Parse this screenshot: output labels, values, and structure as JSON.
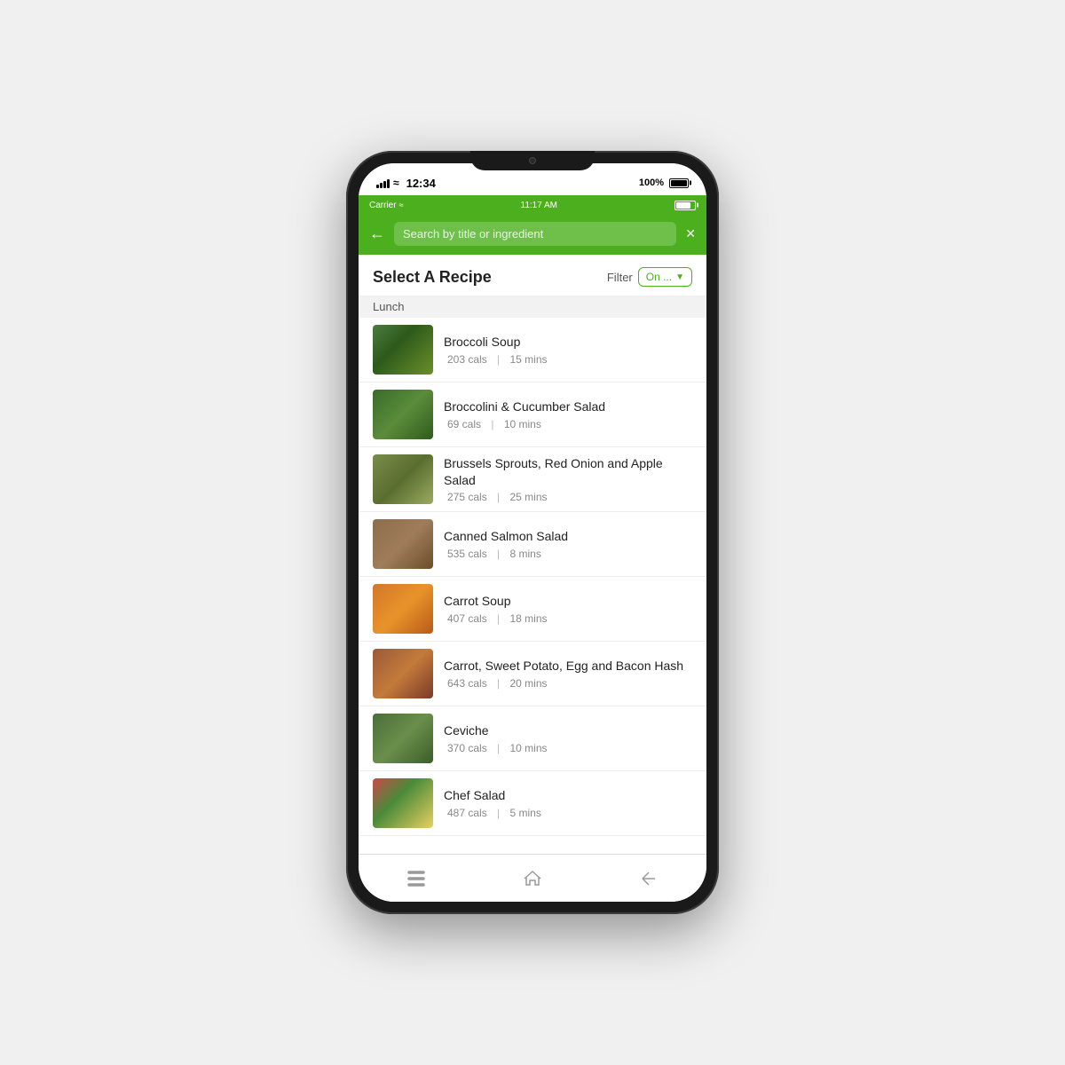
{
  "phone": {
    "os_time": "12:34",
    "os_battery": "100%",
    "app_carrier": "Carrier",
    "app_time": "11:17 AM"
  },
  "header": {
    "search_placeholder": "Search by title or ingredient",
    "page_title": "Select A Recipe",
    "filter_label": "Filter",
    "filter_value": "On ..."
  },
  "section": {
    "lunch_label": "Lunch"
  },
  "recipes": [
    {
      "name": "Broccoli Soup",
      "cals": "203 cals",
      "time": "15 mins",
      "food_class": "food-broccoli-soup",
      "emoji": "🥦"
    },
    {
      "name": "Broccolini & Cucumber Salad",
      "cals": "69 cals",
      "time": "10 mins",
      "food_class": "food-broccolini-salad",
      "emoji": "🥗"
    },
    {
      "name": "Brussels Sprouts, Red Onion and Apple Salad",
      "cals": "275 cals",
      "time": "25 mins",
      "food_class": "food-brussels-sprouts",
      "emoji": "🥙"
    },
    {
      "name": "Canned Salmon Salad",
      "cals": "535 cals",
      "time": "8 mins",
      "food_class": "food-canned-salmon",
      "emoji": "🐟"
    },
    {
      "name": "Carrot Soup",
      "cals": "407 cals",
      "time": "18 mins",
      "food_class": "food-carrot-soup",
      "emoji": "🥕"
    },
    {
      "name": "Carrot, Sweet Potato, Egg and Bacon Hash",
      "cals": "643 cals",
      "time": "20 mins",
      "food_class": "food-carrot-hash",
      "emoji": "🍳"
    },
    {
      "name": "Ceviche",
      "cals": "370 cals",
      "time": "10 mins",
      "food_class": "food-ceviche",
      "emoji": "🐠"
    },
    {
      "name": "Chef Salad",
      "cals": "487 cals",
      "time": "5 mins",
      "food_class": "food-chef-salad",
      "emoji": "🥗"
    }
  ],
  "nav": {
    "menu_label": "Menu",
    "home_label": "Home",
    "back_label": "Back"
  }
}
